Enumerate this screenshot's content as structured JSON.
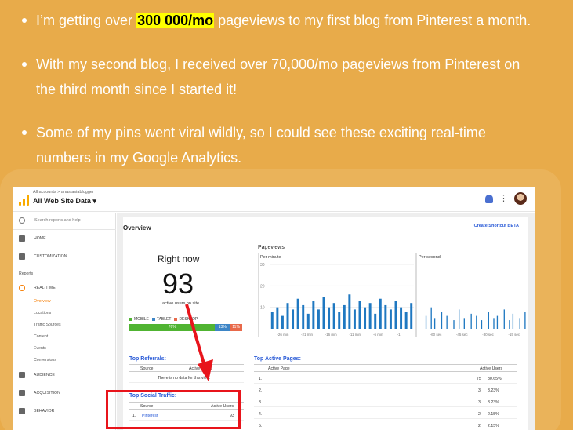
{
  "bullets": [
    {
      "before": "I’m getting over ",
      "highlight": "300 000/mo",
      "after": " pageviews to my first blog from Pinterest a month."
    },
    {
      "line1": "With my second blog, I received over 70,000/mo pageviews from Pinterest on",
      "line2": "the third month since I started it!"
    },
    {
      "line1": "Some of my pins went viral wildly, so I could see these exciting real-time",
      "line2": "numbers in my Google Analytics."
    }
  ],
  "colors": {
    "page_bg": "#e8ab4a",
    "highlight": "#ffff00",
    "accent": "#f57c00",
    "link": "#2a5bd7",
    "red": "#e8141b",
    "chart_bar": "#1f78c1"
  },
  "ga": {
    "crumb": "All accounts > anastasiablogger",
    "property": "All Web Site Data ▾",
    "search_placeholder": "Search reports and help",
    "nav": {
      "home": "HOME",
      "customization": "CUSTOMIZATION",
      "reports": "Reports",
      "realtime": "REAL-TIME",
      "sub": [
        "Overview",
        "Locations",
        "Traffic Sources",
        "Content",
        "Events",
        "Conversions"
      ],
      "audience": "AUDIENCE",
      "acquisition": "ACQUISITION",
      "behavior": "BEHAVIOR"
    },
    "overview_title": "Overview",
    "shortcut": "Create Shortcut BETA",
    "right_now": {
      "title": "Right now",
      "count": "93",
      "subtitle": "active users on site",
      "legend": [
        "MOBILE",
        "TABLET",
        "DESKTOP"
      ],
      "split": [
        {
          "label": "76%",
          "value": 76,
          "color": "#50b432"
        },
        {
          "label": "13%",
          "value": 13,
          "color": "#3d85c6"
        },
        {
          "label": "11%",
          "value": 11,
          "color": "#e8694a"
        }
      ]
    },
    "pageviews": {
      "title": "Pageviews",
      "per_minute": "Per minute",
      "per_second": "Per second",
      "y_ticks": [
        "30",
        "20",
        "10"
      ],
      "x_min_ticks": [
        "-26 min",
        "-21 min",
        "-16 min",
        "-11 min",
        "-6 min",
        "-1"
      ],
      "x_sec_ticks": [
        "-60 sec",
        "-45 sec",
        "-30 sec",
        "-15 sec"
      ]
    },
    "top_referrals": {
      "title": "Top Referrals:",
      "col_source": "Source",
      "col_active": "Active Users",
      "empty": "There is no data for this view."
    },
    "top_social": {
      "title": "Top Social Traffic:",
      "col_source": "Source",
      "col_active": "Active Users",
      "rows": [
        {
          "n": "1.",
          "source": "Pinterest",
          "value": "93"
        }
      ]
    },
    "top_pages": {
      "title": "Top Active Pages:",
      "col_page": "Active Page",
      "col_active": "Active Users",
      "rows": [
        {
          "n": "1.",
          "users": "75",
          "pct": "80.65%"
        },
        {
          "n": "2.",
          "users": "3",
          "pct": "3.23%"
        },
        {
          "n": "3.",
          "users": "3",
          "pct": "3.23%"
        },
        {
          "n": "4.",
          "users": "2",
          "pct": "2.15%"
        },
        {
          "n": "5.",
          "users": "2",
          "pct": "2.15%"
        }
      ]
    }
  },
  "chart_data": [
    {
      "type": "bar",
      "title": "Per minute",
      "ylim": [
        0,
        30
      ],
      "values": [
        8,
        10,
        6,
        12,
        9,
        14,
        11,
        7,
        13,
        9,
        15,
        10,
        12,
        8,
        11,
        16,
        9,
        13,
        10,
        12,
        7,
        14,
        11,
        9,
        13,
        10,
        8,
        12
      ]
    },
    {
      "type": "bar",
      "title": "Per second",
      "ylim": [
        0,
        30
      ],
      "values": [
        0,
        0,
        6,
        0,
        0,
        10,
        0,
        5,
        0,
        0,
        0,
        8,
        0,
        0,
        6,
        0,
        0,
        0,
        4,
        0,
        0,
        9,
        0,
        0,
        5,
        0,
        0,
        0,
        7,
        0,
        0,
        6,
        0,
        0,
        4,
        0,
        0,
        0,
        8,
        0,
        0,
        5,
        0,
        6,
        0,
        0,
        0,
        9,
        0,
        0,
        4,
        0,
        7,
        0,
        0,
        0,
        5,
        0,
        0,
        8
      ]
    }
  ]
}
